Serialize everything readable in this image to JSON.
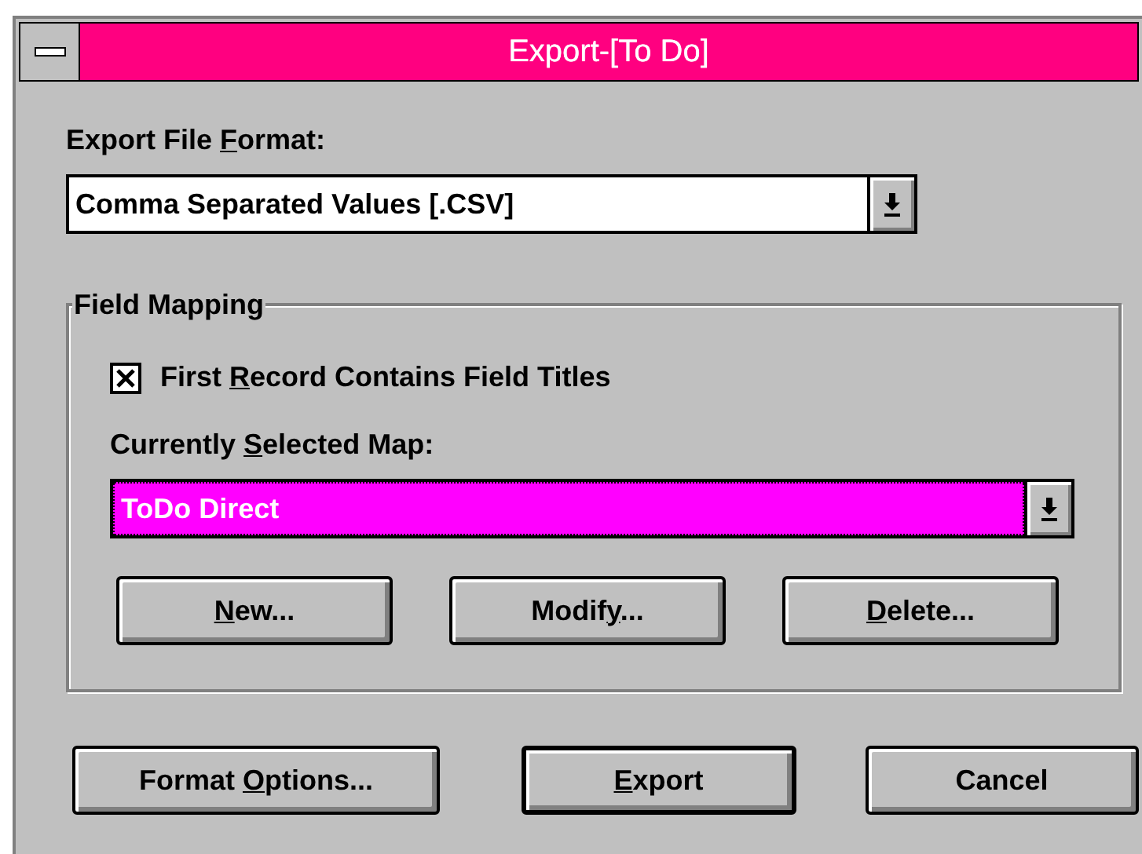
{
  "window": {
    "title": "Export-[To Do]"
  },
  "export_format": {
    "label": {
      "before": "Export File ",
      "key": "F",
      "after": "ormat:"
    },
    "value": "Comma Separated Values [.CSV]",
    "focused": false
  },
  "field_mapping": {
    "title": "Field Mapping",
    "first_record_titles": {
      "label": {
        "before": "First ",
        "key": "R",
        "after": "ecord Contains Field Titles"
      },
      "checked": true
    },
    "map": {
      "label": {
        "before": "Currently ",
        "key": "S",
        "after": "elected Map:"
      },
      "value": "ToDo Direct",
      "focused": true
    },
    "buttons": [
      {
        "label": {
          "key": "N",
          "after": "ew..."
        },
        "default": false
      },
      {
        "label": {
          "before": "Modif",
          "key": "y",
          "after": "..."
        },
        "default": false
      },
      {
        "label": {
          "key": "D",
          "after": "elete..."
        },
        "default": false
      }
    ]
  },
  "buttons": [
    {
      "label": {
        "before": "Format ",
        "key": "O",
        "after": "ptions..."
      },
      "default": false
    },
    {
      "label": {
        "key": "E",
        "after": "xport"
      },
      "default": true
    },
    {
      "label": {
        "before": "Cancel"
      },
      "default": false
    }
  ]
}
